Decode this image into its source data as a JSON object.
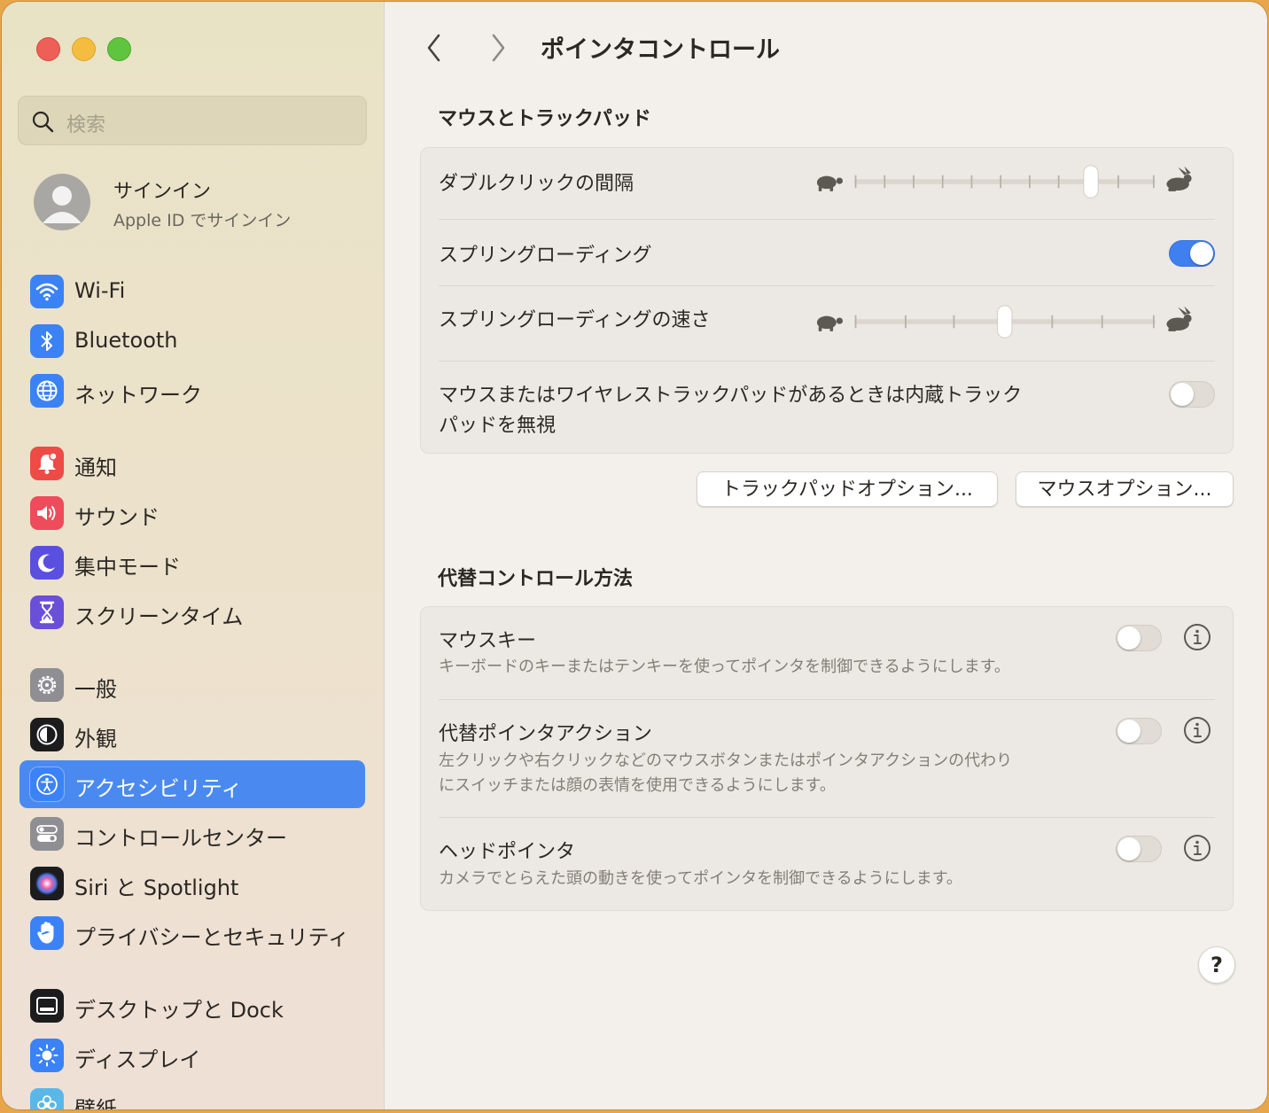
{
  "search": {
    "placeholder": "検索"
  },
  "account": {
    "name": "サインイン",
    "subtitle": "Apple ID でサインイン"
  },
  "sidebar": {
    "items": [
      {
        "label": "Wi-Fi",
        "icon": "wifi-icon",
        "color": "#3b82f6"
      },
      {
        "label": "Bluetooth",
        "icon": "bluetooth-icon",
        "color": "#3b82f6"
      },
      {
        "label": "ネットワーク",
        "icon": "globe-icon",
        "color": "#3b82f6"
      },
      {
        "label": "通知",
        "icon": "bell-icon",
        "color": "#ee4b46"
      },
      {
        "label": "サウンド",
        "icon": "speaker-icon",
        "color": "#ee4b5b"
      },
      {
        "label": "集中モード",
        "icon": "moon-icon",
        "color": "#5b4fe0"
      },
      {
        "label": "スクリーンタイム",
        "icon": "hourglass-icon",
        "color": "#6a4fd8"
      },
      {
        "label": "一般",
        "icon": "gear-icon",
        "color": "#8e8e93"
      },
      {
        "label": "外観",
        "icon": "appearance-icon",
        "color": "#1c1c1e"
      },
      {
        "label": "アクセシビリティ",
        "icon": "accessibility-icon",
        "color": "#3b82f6",
        "active": true
      },
      {
        "label": "コントロールセンター",
        "icon": "toggles-icon",
        "color": "#8e8e93"
      },
      {
        "label": "Siri と Spotlight",
        "icon": "siri-icon",
        "color": "#1c1c1e"
      },
      {
        "label": "プライバシーとセキュリティ",
        "icon": "hand-icon",
        "color": "#3b82f6"
      },
      {
        "label": "デスクトップと Dock",
        "icon": "dock-icon",
        "color": "#1c1c1e"
      },
      {
        "label": "ディスプレイ",
        "icon": "sun-icon",
        "color": "#3b82f6"
      },
      {
        "label": "壁紙",
        "icon": "flower-icon",
        "color": "#5ab8e8"
      }
    ]
  },
  "header": {
    "title": "ポインタコントロール"
  },
  "mouse_section": {
    "title": "マウスとトラックパッド",
    "double_click": {
      "label": "ダブルクリックの間隔",
      "value": 0.8
    },
    "spring_loading": {
      "label": "スプリングローディング",
      "on": true
    },
    "spring_speed": {
      "label": "スプリングローディングの速さ",
      "value": 0.5
    },
    "ignore_trackpad": {
      "label_line1": "マウスまたはワイヤレストラックパッドがあるときは内蔵トラック",
      "label_line2": "パッドを無視",
      "on": false
    }
  },
  "buttons": {
    "trackpad_options": "トラックパッドオプション...",
    "mouse_options": "マウスオプション..."
  },
  "alt_section": {
    "title": "代替コントロール方法",
    "mouse_keys": {
      "label": "マウスキー",
      "desc": "キーボードのキーまたはテンキーを使ってポインタを制御できるようにします。",
      "on": false
    },
    "alt_pointer": {
      "label": "代替ポインタアクション",
      "desc_line1": "左クリックや右クリックなどのマウスボタンまたはポインタアクションの代わり",
      "desc_line2": "にスイッチまたは顔の表情を使用できるようにします。",
      "on": false
    },
    "head_pointer": {
      "label": "ヘッドポインタ",
      "desc": "カメラでとらえた頭の動きを使ってポインタを制御できるようにします。",
      "on": false
    }
  },
  "help": {
    "label": "?"
  }
}
